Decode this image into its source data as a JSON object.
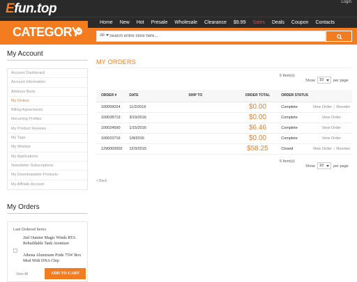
{
  "brand": {
    "logo_prefix": "E",
    "logo_main": "fun.top",
    "user_text": "Login"
  },
  "nav": {
    "items": [
      {
        "label": "Home",
        "red": false
      },
      {
        "label": "New",
        "red": false
      },
      {
        "label": "Hot",
        "red": false
      },
      {
        "label": "Presale",
        "red": false
      },
      {
        "label": "Wholesale",
        "red": false
      },
      {
        "label": "Clearance",
        "red": false
      },
      {
        "label": "$9.99",
        "red": false
      },
      {
        "label": "Sales",
        "red": true
      },
      {
        "label": "Deals",
        "red": false
      },
      {
        "label": "Coupon",
        "red": false
      },
      {
        "label": "Contacts",
        "red": false
      }
    ]
  },
  "category": {
    "label": "CATEGORY"
  },
  "search": {
    "scope": "All",
    "placeholder": "Search entire store here..."
  },
  "sidebar": {
    "account_title": "My Account",
    "menu": [
      {
        "label": "Account Dashboard",
        "active": false
      },
      {
        "label": "Account Information",
        "active": false
      },
      {
        "label": "Address Book",
        "active": false
      },
      {
        "label": "My Orders",
        "active": true
      },
      {
        "label": "Billing Agreements",
        "active": false
      },
      {
        "label": "Recurring Profiles",
        "active": false
      },
      {
        "label": "My Product Reviews",
        "active": false
      },
      {
        "label": "My Tags",
        "active": false
      },
      {
        "label": "My Wishlist",
        "active": false
      },
      {
        "label": "My Applications",
        "active": false
      },
      {
        "label": "Newsletter Subscriptions",
        "active": false
      },
      {
        "label": "My Downloadable Products",
        "active": false
      },
      {
        "label": "My Affiliate Account",
        "active": false
      }
    ],
    "orders_title": "My Orders",
    "recent": {
      "heading": "Last Ordered Items",
      "products": [
        "2ml Oumier Magic Winds RTA Rebuildable Tank Atomizer",
        "Athena Aluminum Pride 75W Box Mod With DNA Chip"
      ],
      "view_all": "View All",
      "add_to_cart": "ADD TO CART"
    }
  },
  "main": {
    "title": "MY ORDERS",
    "items_count": "5 Item(s)",
    "show_label": "Show",
    "per_page_value": "10",
    "per_page_label": "per page",
    "table": {
      "headers": [
        "ORDER #",
        "DATE",
        "SHIP TO",
        "ORDER TOTAL",
        "ORDER STATUS",
        ""
      ],
      "rows": [
        {
          "order": "100059024",
          "date": "11/2/2016",
          "ship_to": "",
          "total": "$0.00",
          "status": "Complete",
          "view": "View Order",
          "reorder": "Reorder"
        },
        {
          "order": "100028719",
          "date": "3/19/2016",
          "ship_to": "",
          "total": "$0.00",
          "status": "Complete",
          "view": "View Order",
          "reorder": ""
        },
        {
          "order": "100024590",
          "date": "1/15/2016",
          "ship_to": "",
          "total": "$6.46",
          "status": "Complete",
          "view": "View Order",
          "reorder": ""
        },
        {
          "order": "100023716",
          "date": "1/8/2016",
          "ship_to": "",
          "total": "$0.00",
          "status": "Complete",
          "view": "View Order",
          "reorder": ""
        },
        {
          "order": "1290000002",
          "date": "12/3/2015",
          "ship_to": "",
          "total": "$58.25",
          "status": "Closed",
          "view": "View Order",
          "reorder": "Reorder"
        }
      ]
    },
    "back_label": "« Back"
  },
  "colors": {
    "accent": "#f47c20",
    "dark": "#2a2a2a",
    "sale_red": "#ff3b3b"
  }
}
